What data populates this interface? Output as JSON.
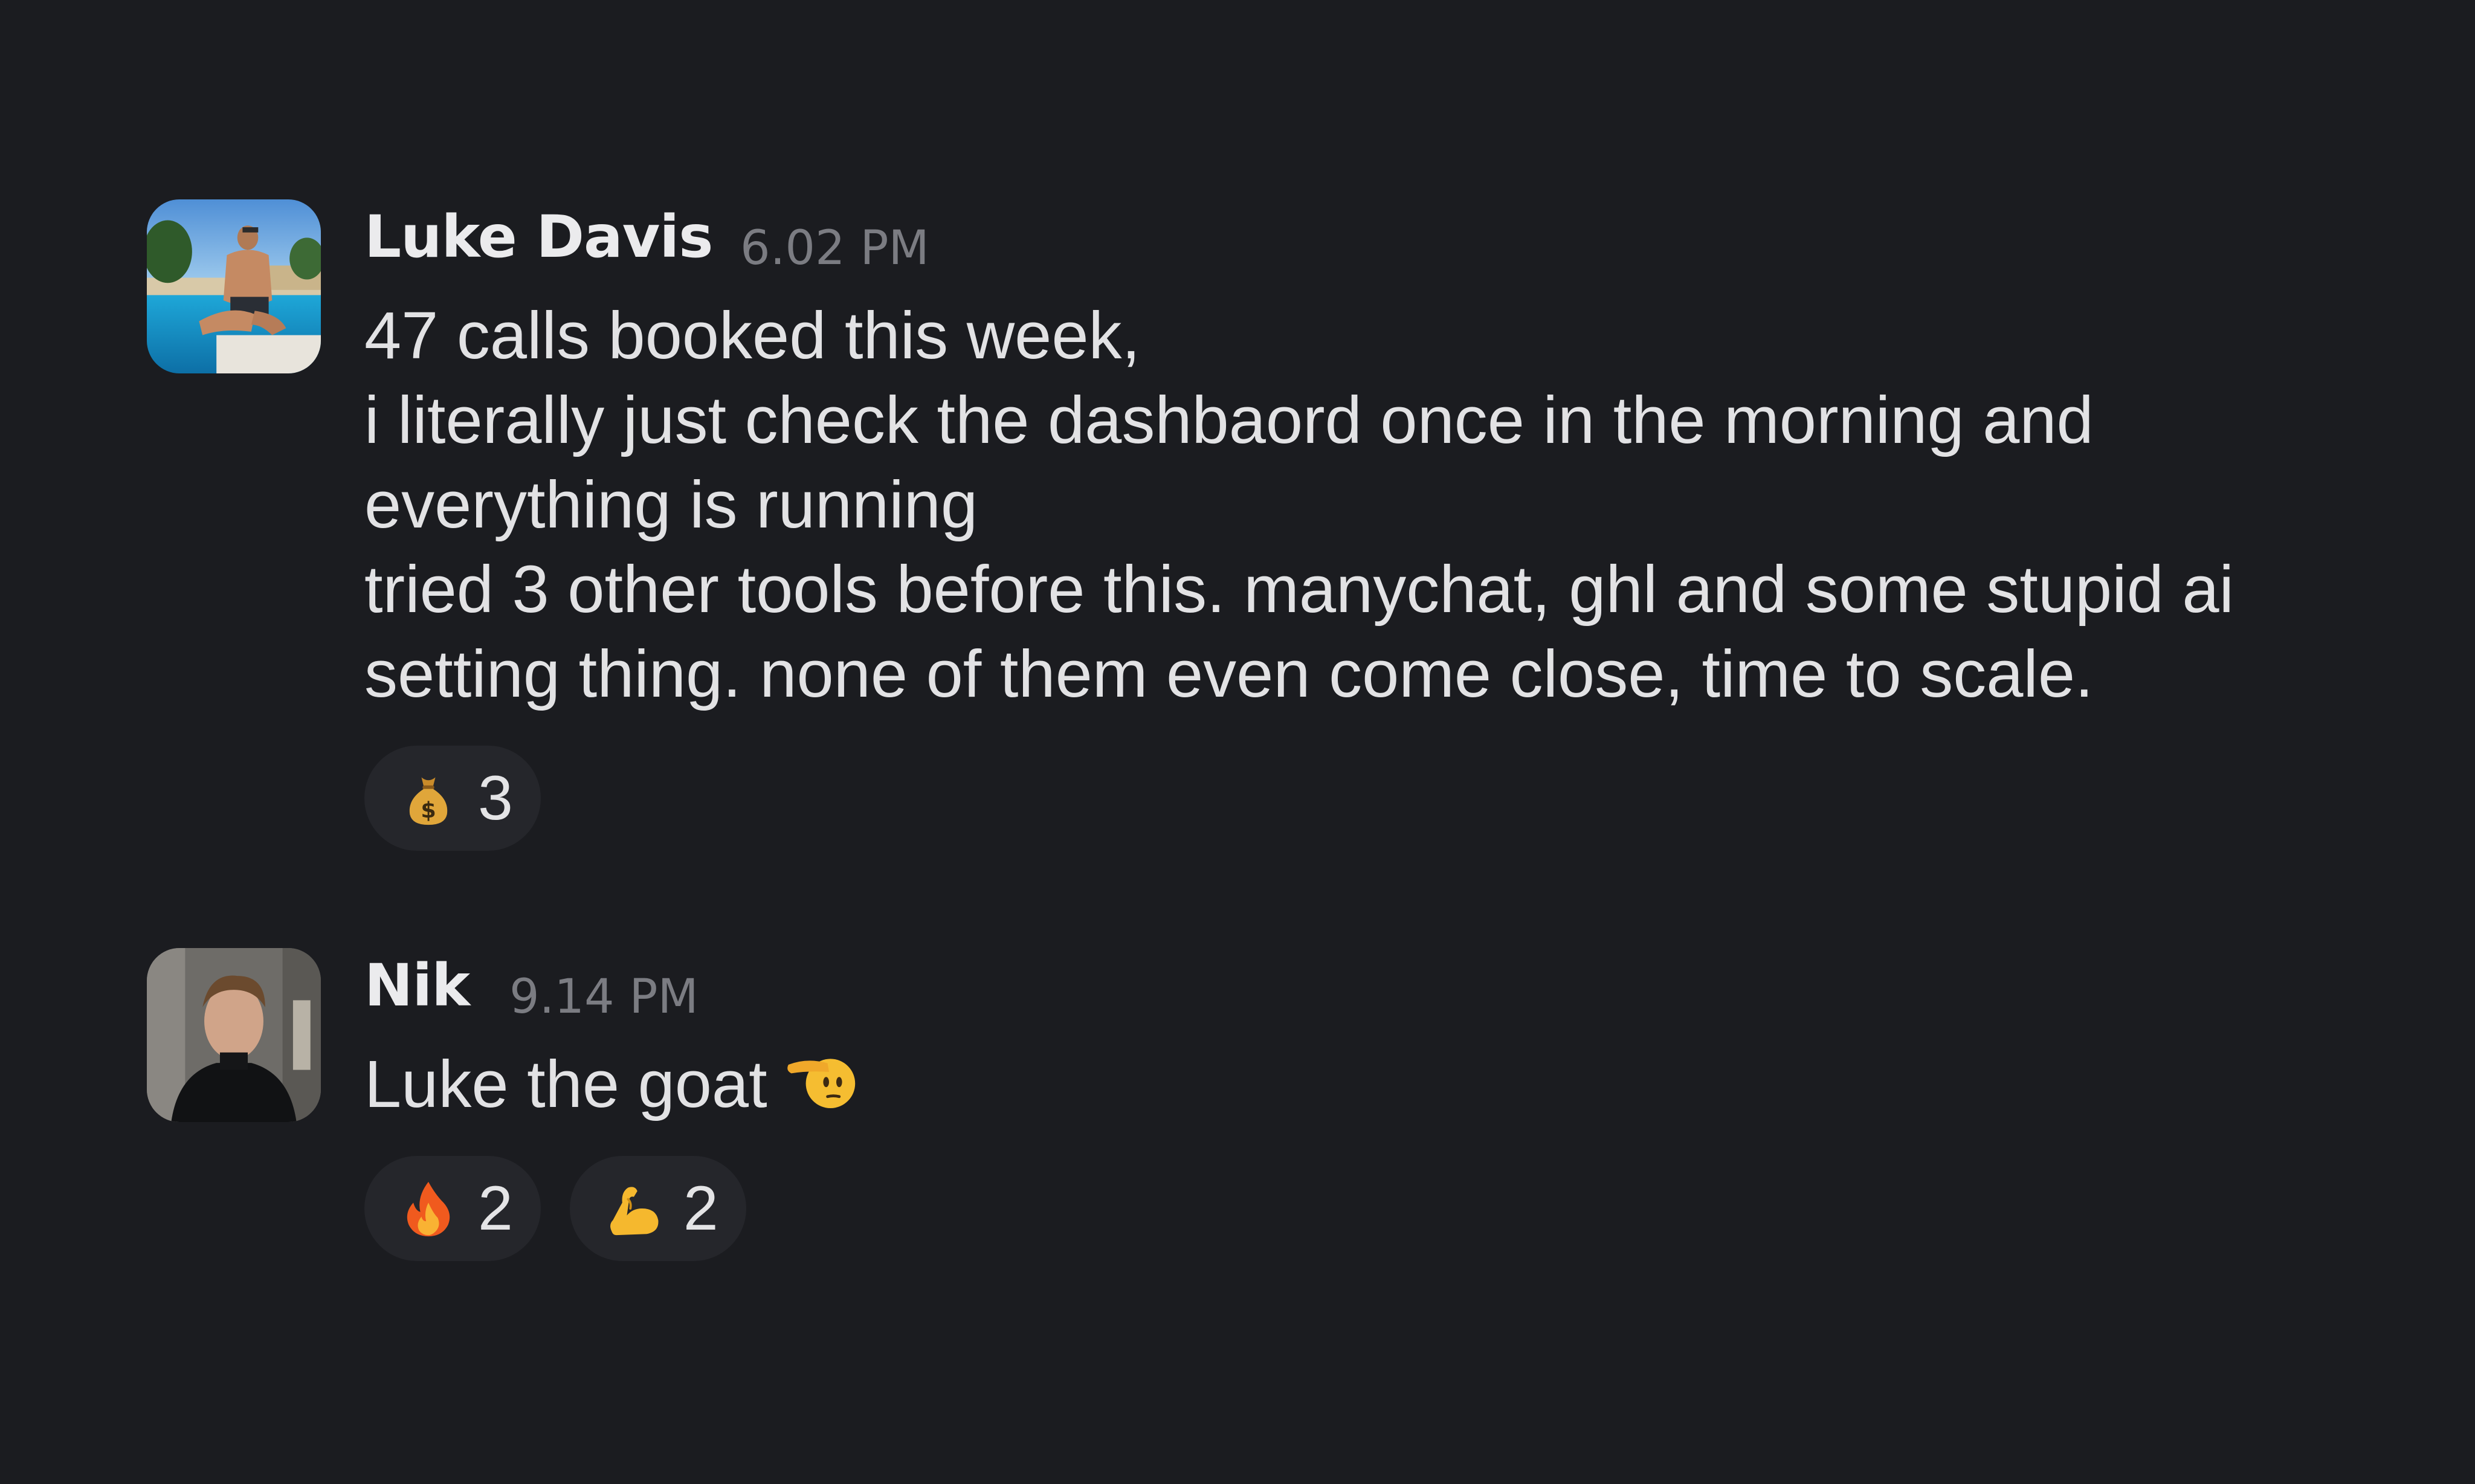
{
  "messages": [
    {
      "author": "Luke Davis",
      "timestamp": "6.02 PM",
      "lines": [
        "47 calls booked this week,",
        "i literally just check the dashbaord once in the morning and",
        "everything is running",
        "tried 3 other tools before this. manychat, ghl and some stupid ai",
        "setting thing. none of them even come close, time to scale."
      ],
      "reactions": [
        {
          "emoji": "money-bag",
          "count": "3"
        }
      ]
    },
    {
      "author": "Nik",
      "timestamp": "9.14 PM",
      "lines": [
        "Luke the goat"
      ],
      "trailing_emoji": "saluting-face",
      "reactions": [
        {
          "emoji": "fire",
          "count": "2"
        },
        {
          "emoji": "flexed-biceps",
          "count": "2"
        }
      ]
    }
  ]
}
